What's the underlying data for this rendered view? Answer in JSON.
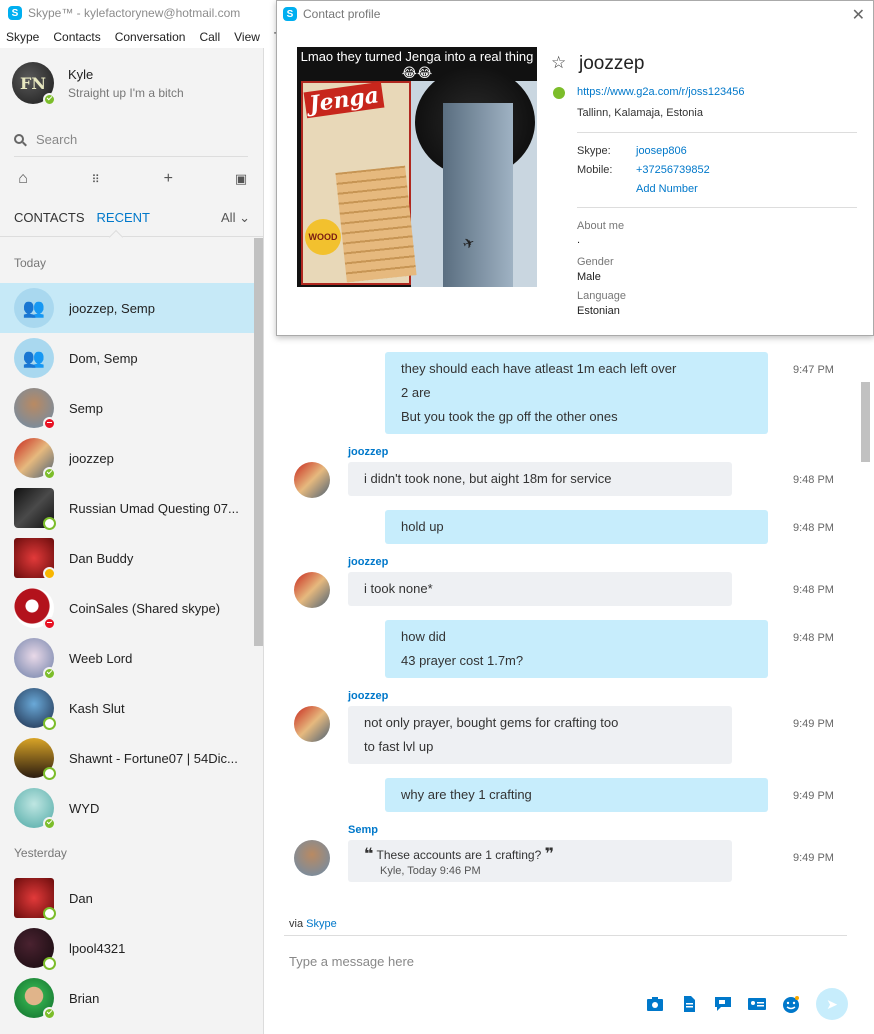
{
  "window": {
    "title": "Skype™ - kylefactorynew@hotmail.com",
    "logo_letter": "S"
  },
  "menu": [
    "Skype",
    "Contacts",
    "Conversation",
    "Call",
    "View",
    "T"
  ],
  "profile": {
    "name": "Kyle",
    "mood": "Straight up I'm a bitch",
    "avatar_text": "FN",
    "status": "online"
  },
  "search": {
    "placeholder": "Search"
  },
  "toolbar_icons": [
    "home-icon",
    "dialpad-icon",
    "add-icon",
    "bot-icon"
  ],
  "tabs": {
    "contacts": "CONTACTS",
    "recent": "RECENT",
    "filter": "All"
  },
  "sections": {
    "today": "Today",
    "yesterday": "Yesterday"
  },
  "contacts": [
    {
      "name": "joozzep, Semp",
      "status": "group",
      "selected": true
    },
    {
      "name": "Dom, Semp",
      "status": "group"
    },
    {
      "name": "Semp",
      "status": "dnd"
    },
    {
      "name": "joozzep",
      "status": "online"
    },
    {
      "name": "Russian Umad Questing 07...",
      "status": "offline"
    },
    {
      "name": "Dan Buddy",
      "status": "away"
    },
    {
      "name": "CoinSales  (Shared skype)",
      "status": "dnd"
    },
    {
      "name": "Weeb Lord",
      "status": "online"
    },
    {
      "name": "Kash Slut",
      "status": "offline"
    },
    {
      "name": "Shawnt - Fortune07 | 54Dic...",
      "status": "offline"
    },
    {
      "name": "WYD",
      "status": "online"
    }
  ],
  "contacts_yesterday": [
    {
      "name": "Dan",
      "status": "offline"
    },
    {
      "name": "lpool4321",
      "status": "offline"
    },
    {
      "name": "Brian",
      "status": "online"
    }
  ],
  "messages": {
    "m1": {
      "lines": [
        "they should each have atleast 1m each left over",
        "2 are",
        "But you took the gp off the other ones"
      ],
      "time": "9:47 PM"
    },
    "m2": {
      "sender": "joozzep",
      "text": "i didn't took none, but aight 18m for service",
      "time": "9:48 PM"
    },
    "m3": {
      "text": "hold up",
      "time": "9:48 PM"
    },
    "m4": {
      "sender": "joozzep",
      "text": "i took none*",
      "time": "9:48 PM"
    },
    "m5": {
      "lines": [
        "how did",
        "43 prayer cost 1.7m?"
      ],
      "time": "9:48 PM"
    },
    "m6": {
      "sender": "joozzep",
      "lines": [
        "not only prayer, bought gems for crafting too",
        "to fast lvl up"
      ],
      "time": "9:49 PM"
    },
    "m7": {
      "text": "why are they 1 crafting",
      "time": "9:49 PM"
    },
    "m8": {
      "sender": "Semp",
      "quote": "These accounts are 1 crafting?",
      "quote_meta": "Kyle, Today 9:46 PM",
      "time": "9:49 PM"
    }
  },
  "composer": {
    "via_prefix": "via",
    "via_link": "Skype",
    "placeholder": "Type a message here",
    "icons": [
      "media-icon",
      "file-icon",
      "video-message-icon",
      "contact-card-icon",
      "emoticon-icon",
      "send-icon"
    ]
  },
  "contact_profile": {
    "window_title": "Contact profile",
    "image_caption": "Lmao they turned Jenga into a real thing😂😂",
    "image_brand": "Jenga",
    "image_badge": "WOOD",
    "name": "joozzep",
    "link": "https://www.g2a.com/r/joss123456",
    "location": "Tallinn, Kalamaja, Estonia",
    "skype_label": "Skype:",
    "skype_value": "joosep806",
    "mobile_label": "Mobile:",
    "mobile_value": "+37256739852",
    "add_number": "Add Number",
    "about_label": "About me",
    "about_value": ".",
    "gender_label": "Gender",
    "gender_value": "Male",
    "language_label": "Language",
    "language_value": "Estonian"
  },
  "colors": {
    "accent": "#0078ca",
    "selected_row": "#c6e9f7",
    "my_bubble": "#c7edfc",
    "their_bubble": "#eef0f3",
    "online": "#7cbd2a",
    "dnd": "#e81123",
    "away": "#f8b600"
  }
}
